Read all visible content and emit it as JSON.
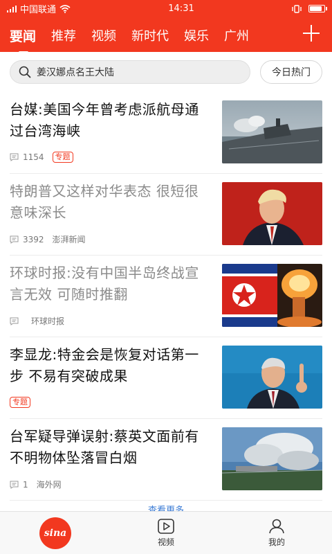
{
  "status_bar": {
    "carrier": "中国联通",
    "time": "14:31",
    "battery_level": 0.9
  },
  "channels": {
    "tabs": [
      {
        "label": "要闻",
        "active": true
      },
      {
        "label": "推荐",
        "active": false
      },
      {
        "label": "视频",
        "active": false
      },
      {
        "label": "新时代",
        "active": false
      },
      {
        "label": "娱乐",
        "active": false
      },
      {
        "label": "广州",
        "active": false
      }
    ],
    "add_icon": "plus-icon"
  },
  "search": {
    "placeholder": "姜汉娜点名王大陆",
    "hot_button": "今日热门"
  },
  "feed": {
    "items": [
      {
        "title": "台媒:美国今年曾考虑派航母通过台湾海峡",
        "comments": "1154",
        "source": "",
        "tag": "专题",
        "read": false,
        "thumb": "warship"
      },
      {
        "title": "特朗普又这样对华表态 很短很意味深长",
        "comments": "3392",
        "source": "澎湃新闻",
        "tag": "",
        "read": true,
        "thumb": "trump"
      },
      {
        "title": "环球时报:没有中国半岛终战宣言无效 可随时推翻",
        "comments": "",
        "source": "环球时报",
        "tag": "",
        "read": true,
        "thumb": "flag-explosion"
      },
      {
        "title": "李显龙:特金会是恢复对话第一步 不易有突破成果",
        "comments": "",
        "source": "",
        "tag": "专题",
        "read": false,
        "thumb": "speaker"
      },
      {
        "title": "台军疑导弹误射:蔡英文面前有不明物体坠落冒白烟",
        "comments": "1",
        "source": "海外网",
        "tag": "",
        "read": false,
        "thumb": "smoke"
      }
    ],
    "load_more": "查看更多"
  },
  "bottom_nav": {
    "home_logo": "sina",
    "items": [
      {
        "label": "视频",
        "icon": "play-icon"
      },
      {
        "label": "我的",
        "icon": "user-icon"
      }
    ]
  },
  "colors": {
    "brand": "#f2381f",
    "link": "#3a7bd5"
  }
}
